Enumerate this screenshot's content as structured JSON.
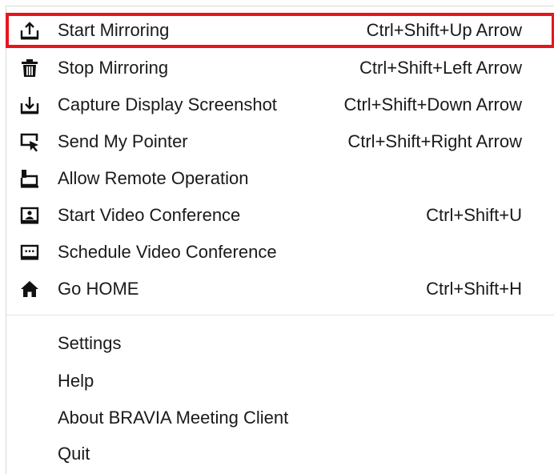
{
  "menu": {
    "items": [
      {
        "label": "Start Mirroring",
        "shortcut": "Ctrl+Shift+Up Arrow",
        "icon": "upload-screen-icon",
        "highlighted": true
      },
      {
        "label": "Stop Mirroring",
        "shortcut": "Ctrl+Shift+Left Arrow",
        "icon": "trash-icon"
      },
      {
        "label": "Capture Display Screenshot",
        "shortcut": "Ctrl+Shift+Down Arrow",
        "icon": "download-screen-icon"
      },
      {
        "label": "Send My Pointer",
        "shortcut": "Ctrl+Shift+Right Arrow",
        "icon": "pointer-screen-icon"
      },
      {
        "label": "Allow Remote Operation",
        "shortcut": "",
        "icon": "remote-operation-icon"
      },
      {
        "label": "Start Video Conference",
        "shortcut": "Ctrl+Shift+U",
        "icon": "video-conference-icon"
      },
      {
        "label": "Schedule Video Conference",
        "shortcut": "",
        "icon": "schedule-conference-icon"
      },
      {
        "label": "Go HOME",
        "shortcut": "Ctrl+Shift+H",
        "icon": "home-icon"
      }
    ],
    "secondary_items": [
      {
        "label": "Settings"
      },
      {
        "label": "Help"
      },
      {
        "label": "About BRAVIA Meeting Client"
      },
      {
        "label": "Quit"
      }
    ]
  },
  "colors": {
    "highlight_border": "#e8141e",
    "text": "#1a1a1a",
    "separator": "#e3e3e3"
  }
}
